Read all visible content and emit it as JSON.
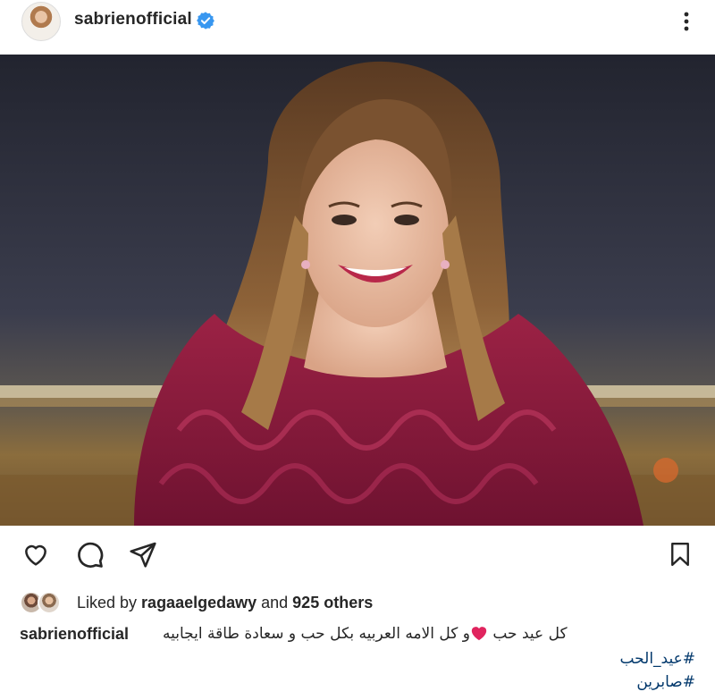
{
  "header": {
    "username": "sabrienofficial",
    "verified_icon": "verified-badge-icon",
    "more_icon": "more-vertical-icon"
  },
  "post": {
    "image_alt": "photo"
  },
  "actions": {
    "like_icon": "heart-outline-icon",
    "comment_icon": "comment-icon",
    "share_icon": "paper-plane-icon",
    "save_icon": "bookmark-icon"
  },
  "likes": {
    "prefix": "Liked by ",
    "user": "ragaaelgedawy",
    "middle": " and ",
    "others": "925 others"
  },
  "caption": {
    "username": "sabrienofficial",
    "text_part1": "كل عيد حب ",
    "text_part2": "و كل الامه العربيه بكل حب و سعادة طاقة ايجابيه"
  },
  "hashtags": [
    "#عيد_الحب",
    "#صابرين"
  ],
  "colors": {
    "verified": "#3897f0",
    "hashtag": "#00376b",
    "heart": "#e0245e"
  }
}
